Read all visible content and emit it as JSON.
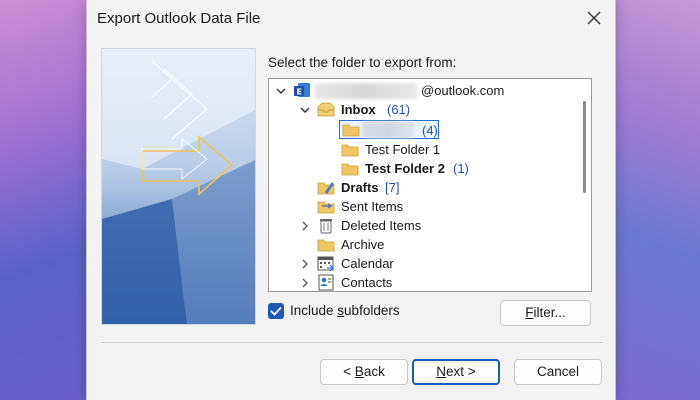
{
  "dialog": {
    "title": "Export Outlook Data File",
    "prompt": "Select the folder to export from:",
    "close_icon": "close-icon"
  },
  "tree": {
    "account_suffix": "@outlook.com",
    "inbox": {
      "label": "Inbox",
      "count": "(61)"
    },
    "selected_folder": {
      "count": "(4)"
    },
    "test_folder_1": {
      "label": "Test Folder 1"
    },
    "test_folder_2": {
      "label": "Test Folder 2",
      "count": "(1)"
    },
    "drafts": {
      "label": "Drafts",
      "count": "[7]"
    },
    "sent_items": {
      "label": "Sent Items"
    },
    "deleted_items": {
      "label": "Deleted Items"
    },
    "archive": {
      "label": "Archive"
    },
    "calendar": {
      "label": "Calendar"
    },
    "contacts": {
      "label": "Contacts"
    }
  },
  "options": {
    "include_subfolders": {
      "prefix": "Include ",
      "accel": "s",
      "rest": "ubfolders",
      "checked": true
    }
  },
  "buttons": {
    "filter": {
      "accel": "F",
      "rest": "ilter..."
    },
    "back": {
      "prefix": "< ",
      "accel": "B",
      "rest": "ack"
    },
    "next": {
      "accel": "N",
      "rest": "ext >"
    },
    "cancel": {
      "label": "Cancel"
    }
  },
  "colors": {
    "accent": "#1e5bb8",
    "folder": "#f0c660",
    "count": "#2a52a8"
  }
}
